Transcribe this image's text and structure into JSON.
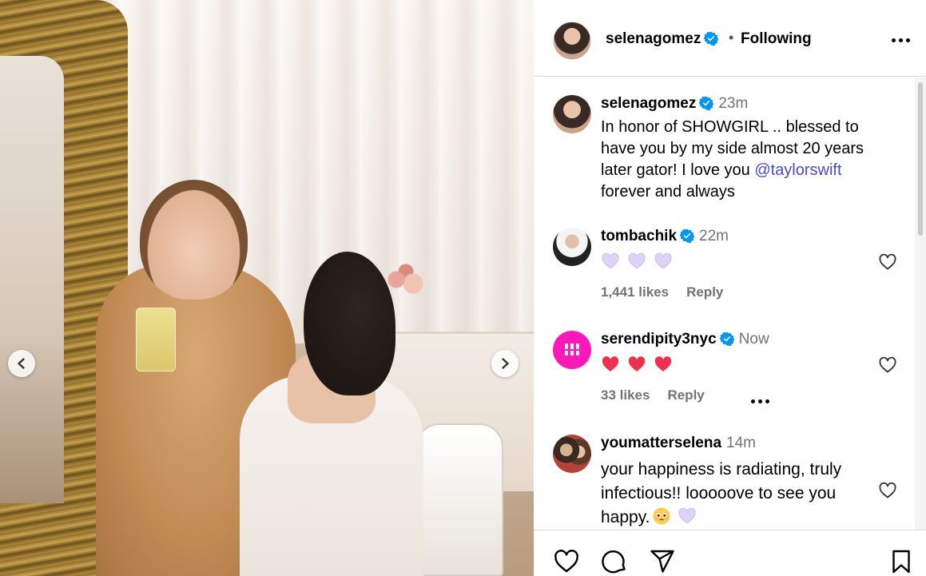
{
  "post": {
    "carousel": {
      "prev_icon": "chevron-left-icon",
      "next_icon": "chevron-right-icon"
    }
  },
  "header": {
    "username": "selenagomez",
    "separator": "•",
    "follow_status": "Following",
    "more_icon": "more-horizontal-icon"
  },
  "caption": {
    "username": "selenagomez",
    "time": "23m",
    "text_before": "In honor of SHOWGIRL .. blessed to have you by my side almost 20 years later gator! I love you ",
    "mention": "@taylorswift",
    "text_after": " forever and always"
  },
  "comments": [
    {
      "username": "tombachik",
      "time": "22m",
      "emojis": [
        "purple-heart",
        "purple-heart",
        "purple-heart"
      ],
      "likes": "1,441 likes",
      "reply": "Reply"
    },
    {
      "username": "serendipity3nyc",
      "time": "Now",
      "emojis": [
        "red-heart",
        "red-heart",
        "red-heart"
      ],
      "likes": "33 likes",
      "reply": "Reply"
    },
    {
      "username": "youmatterselena",
      "time": "14m",
      "text": "your happiness is radiating, truly infectious!! looooove to see you happy.",
      "emojis": [
        "pleading-face",
        "purple-heart"
      ]
    }
  ],
  "actions": {
    "like_icon": "heart-icon",
    "comment_icon": "comment-icon",
    "share_icon": "send-icon",
    "save_icon": "bookmark-icon"
  },
  "colors": {
    "verified": "#0095f6",
    "mention": "#4a4ad1",
    "muted": "#737373",
    "red_heart": "#f0304e",
    "purple_heart": "#d9cff5",
    "serendipity_brand": "#ff18b9"
  }
}
